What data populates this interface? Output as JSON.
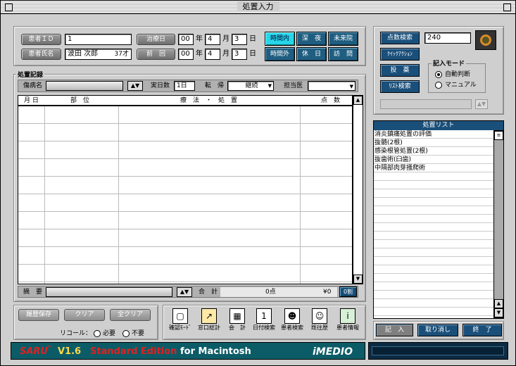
{
  "window": {
    "title": "処置入力"
  },
  "patient": {
    "id_label": "患者ＩＤ",
    "id_value": "1",
    "name_label": "患者氏名",
    "name_value": "波田 次郎",
    "age": "37才"
  },
  "dates": {
    "treat_label": "治療日",
    "prev_label": "前　回",
    "era": "00",
    "year_unit": "年",
    "month": "4",
    "month_unit": "月",
    "day": "3",
    "day_unit": "日"
  },
  "time_buttons": [
    "時間内",
    "深　夜",
    "未来院",
    "時間外",
    "休　日",
    "訪　問"
  ],
  "record": {
    "section": "処置記録",
    "disease_label": "傷病名",
    "days_label": "実日数",
    "days_value": "1日",
    "outcome_label": "転　帰",
    "outcome_value": "継続",
    "doctor_label": "担当医",
    "doctor_value": ""
  },
  "table": {
    "headers": [
      "月 日",
      "部　位",
      "療　法　・　処　置",
      "点　数"
    ]
  },
  "summary": {
    "label": "摘　要",
    "total_label": "合　計",
    "points": "0点",
    "yen": "¥0",
    "zero_btn": "0割"
  },
  "left_buttons": [
    "履歴保存",
    "クリア",
    "全クリア"
  ],
  "recall": {
    "label": "リコール：",
    "opt1": "必要",
    "opt2": "不要"
  },
  "tools": [
    "確認ﾓｰﾄﾞ",
    "窓口総計",
    "会　計",
    "日付検索",
    "患者検索",
    "既往歴",
    "患者情報"
  ],
  "right": {
    "search_btns": [
      "点数検索",
      "ｸｲｯｸｱｸｼｮﾝ",
      "投　薬",
      "ﾘｽﾄ検索"
    ],
    "input_value": "240",
    "mode_label": "記入モード",
    "mode_opt1": "自動判断",
    "mode_opt2": "マニュアル"
  },
  "treatment_list": {
    "title": "処置リスト",
    "items": [
      "消炎鎮痛処置の評価",
      "抜髄(2根)",
      "感染根管処置(2根)",
      "抜歯術(臼歯)",
      "中隔部肉芽掻爬術"
    ]
  },
  "bottom_buttons": [
    "記　入",
    "取り消し",
    "終　了"
  ],
  "brand": {
    "saru": "SARU",
    "tm": "™",
    "version": "V1.6",
    "edition": "Standard Edition",
    "platform": "for Macintosh",
    "logo": "iMEDIO"
  }
}
